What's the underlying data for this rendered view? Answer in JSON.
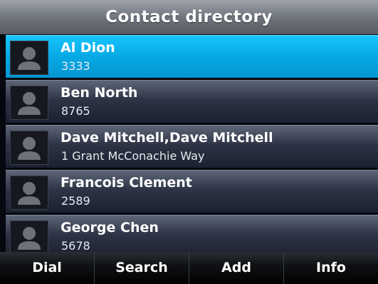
{
  "header": {
    "title": "Contact directory"
  },
  "contacts": [
    {
      "name": "Al Dion",
      "detail": "3333",
      "selected": true
    },
    {
      "name": "Ben North",
      "detail": "8765",
      "selected": false
    },
    {
      "name": "Dave Mitchell,Dave Mitchell",
      "detail": "1 Grant McConachie Way",
      "selected": false
    },
    {
      "name": "Francois Clement",
      "detail": "2589",
      "selected": false
    },
    {
      "name": "George Chen",
      "detail": "5678",
      "selected": false
    }
  ],
  "softkeys": [
    {
      "label": "Dial"
    },
    {
      "label": "Search"
    },
    {
      "label": "Add"
    },
    {
      "label": "Info"
    }
  ],
  "icons": {
    "avatar": "person-silhouette-icon"
  },
  "colors": {
    "selected": "#07a8e4",
    "row": "#2e3445",
    "header": "#6c717a"
  }
}
